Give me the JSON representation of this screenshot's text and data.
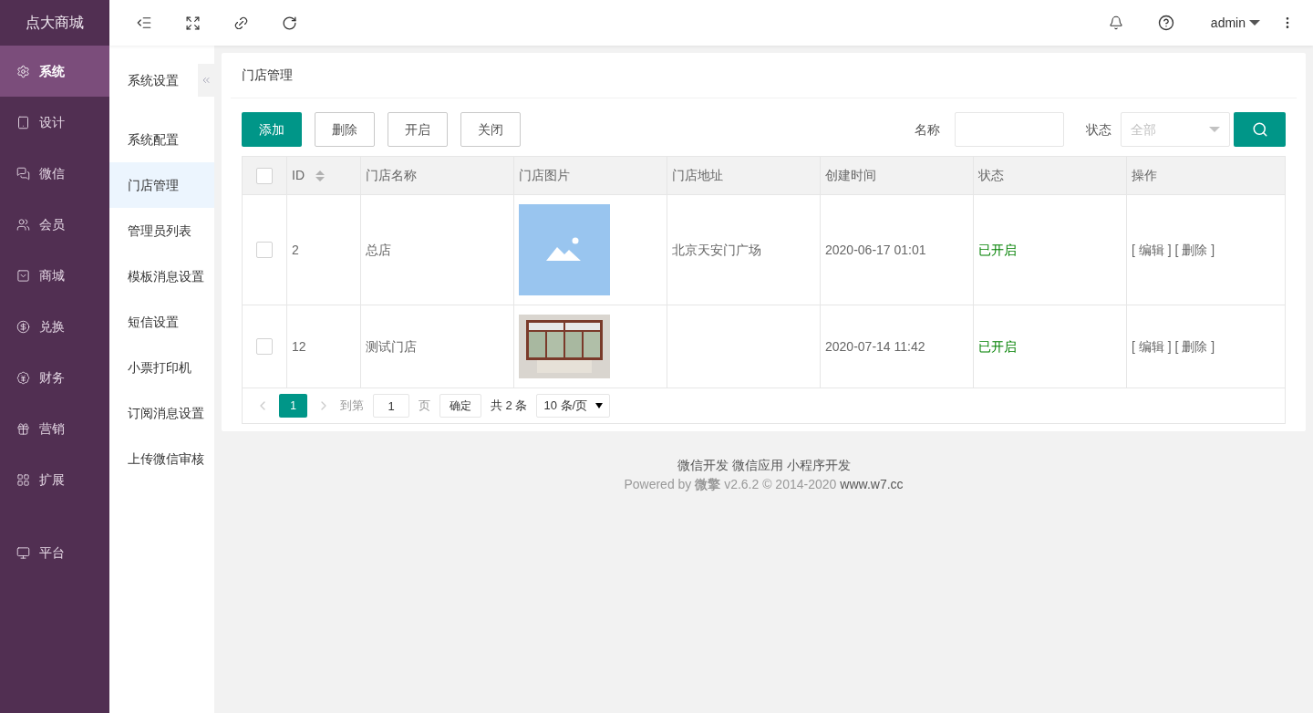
{
  "brand": "点大商城",
  "nav": [
    {
      "label": "系统",
      "selected": true
    },
    {
      "label": "设计",
      "selected": false
    },
    {
      "label": "微信",
      "selected": false
    },
    {
      "label": "会员",
      "selected": false
    },
    {
      "label": "商城",
      "selected": false
    },
    {
      "label": "兑换",
      "selected": false
    },
    {
      "label": "财务",
      "selected": false
    },
    {
      "label": "营销",
      "selected": false
    },
    {
      "label": "扩展",
      "selected": false
    },
    {
      "label": "平台",
      "selected": false
    }
  ],
  "topbar": {
    "user": "admin"
  },
  "submenu": {
    "title": "系统设置",
    "items": [
      {
        "label": "系统配置",
        "selected": false
      },
      {
        "label": "门店管理",
        "selected": true
      },
      {
        "label": "管理员列表",
        "selected": false
      },
      {
        "label": "模板消息设置",
        "selected": false
      },
      {
        "label": "短信设置",
        "selected": false
      },
      {
        "label": "小票打印机",
        "selected": false
      },
      {
        "label": "订阅消息设置",
        "selected": false
      },
      {
        "label": "上传微信审核",
        "selected": false
      }
    ]
  },
  "page_title": "门店管理",
  "toolbar": {
    "buttons": [
      {
        "label": "添加",
        "kind": "primary"
      },
      {
        "label": "删除",
        "kind": "default"
      },
      {
        "label": "开启",
        "kind": "default"
      },
      {
        "label": "关闭",
        "kind": "default"
      }
    ],
    "name_label": "名称",
    "status_label": "状态",
    "status_placeholder": "全部"
  },
  "table": {
    "header_checked": false,
    "columns": [
      "ID",
      "门店名称",
      "门店图片",
      "门店地址",
      "创建时间",
      "状态",
      "操作"
    ],
    "rows": [
      {
        "checked": false,
        "id": "2",
        "name": "总店",
        "kind": "placeholder",
        "address": "北京天安门广场",
        "created": "2020-06-17 01:01",
        "status": "已开启",
        "actions": [
          "[ 编辑 ]",
          "[ 删除 ]"
        ]
      },
      {
        "checked": false,
        "id": "12",
        "name": "测试门店",
        "kind": "photo",
        "created": "2020-07-14 11:42",
        "status": "已开启",
        "actions": [
          "[ 编辑 ]",
          "[ 删除 ]"
        ]
      }
    ]
  },
  "pagination": {
    "pages": [
      {
        "label": "1",
        "selected": true
      }
    ],
    "goto_label": "到第",
    "goto_value": "1",
    "page_unit": "页",
    "confirm": "确定",
    "total": "共 2 条",
    "page_size": "10 条/页"
  },
  "footer": {
    "links": [
      "微信开发",
      "微信应用",
      "小程序开发"
    ],
    "powered": "Powered by **微擎** v2.6.2 © 2014-2020",
    "site": "www.w7.cc"
  }
}
